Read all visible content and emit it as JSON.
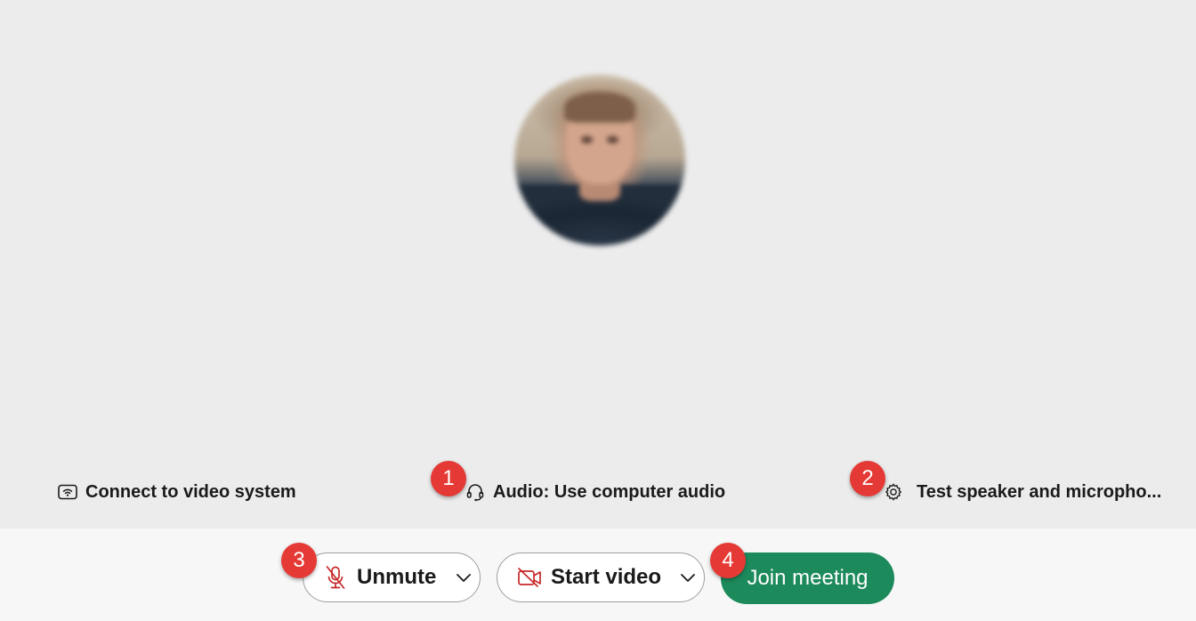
{
  "info_row": {
    "video_system_label": "Connect to video system",
    "audio_label": "Audio: Use computer audio",
    "test_label": "Test speaker and micropho..."
  },
  "controls": {
    "unmute_label": "Unmute",
    "start_video_label": "Start video",
    "join_label": "Join meeting"
  },
  "badges": [
    "1",
    "2",
    "3",
    "4"
  ],
  "colors": {
    "join_green": "#1d8a5c",
    "badge_red": "#e53935",
    "muted_icon_red": "#c62828",
    "stage_bg": "#ececec",
    "bar_bg": "#f7f7f7"
  },
  "icons": {
    "video_system": "video-system-wifi-icon",
    "audio": "headset-icon",
    "test": "gear-icon",
    "unmute": "mic-off-icon",
    "start_video": "video-off-icon",
    "dropdown": "chevron-down-icon"
  }
}
